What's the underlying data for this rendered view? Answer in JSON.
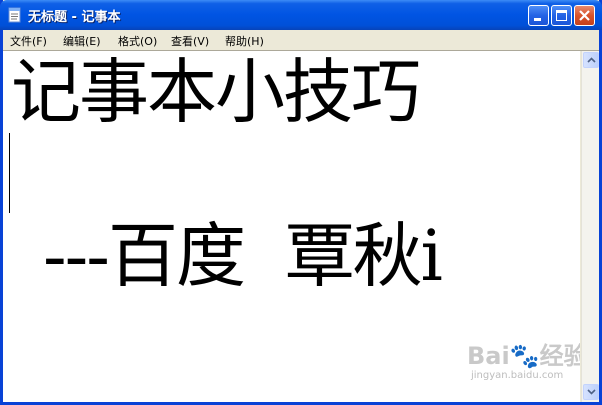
{
  "window": {
    "title": "无标题 - 记事本"
  },
  "menu": {
    "items": [
      {
        "label": "文件(F)"
      },
      {
        "label": "编辑(E)"
      },
      {
        "label": "格式(O)"
      },
      {
        "label": "查看(V)"
      },
      {
        "label": "帮助(H)"
      }
    ]
  },
  "editor": {
    "lines": [
      "记事本小技巧",
      "---百度  覃秋i"
    ]
  },
  "watermark": {
    "logo": "Bai🐾经验",
    "url": "jingyan.baidu.com"
  },
  "colors": {
    "titlebar": "#0054e3",
    "border": "#0842d6",
    "close_button": "#d8532b",
    "menubar": "#ece9d8"
  },
  "icons": {
    "app": "notepad-icon",
    "minimize": "minimize-icon",
    "maximize": "maximize-icon",
    "close": "close-icon",
    "scroll_up": "arrow-up-icon",
    "scroll_down": "arrow-down-icon"
  }
}
